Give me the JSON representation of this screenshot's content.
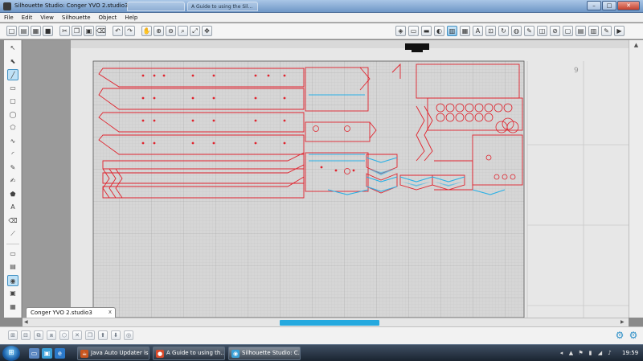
{
  "window": {
    "title": "Silhouette Studio: Conger YVO 2.studio3",
    "ghost_tabs": [
      "",
      "A Guide to using the Sil..."
    ],
    "controls": {
      "minimize": "–",
      "maximize": "□",
      "close": "✕"
    }
  },
  "menu": {
    "items": [
      "File",
      "Edit",
      "View",
      "Silhouette",
      "Object",
      "Help"
    ]
  },
  "toolbar": {
    "left_icons": [
      {
        "name": "new-document-icon",
        "glyph": "□"
      },
      {
        "name": "open-folder-icon",
        "glyph": "▤"
      },
      {
        "name": "open-file-icon",
        "glyph": "▦"
      },
      {
        "name": "save-icon",
        "glyph": "■"
      },
      {
        "name": "cut-icon",
        "glyph": "✂"
      },
      {
        "name": "copy-icon",
        "glyph": "❐"
      },
      {
        "name": "paste-icon",
        "glyph": "▣"
      },
      {
        "name": "clear-icon",
        "glyph": "⌫"
      },
      {
        "name": "undo-icon",
        "glyph": "↶"
      },
      {
        "name": "redo-icon",
        "glyph": "↷"
      },
      {
        "name": "pan-hand-icon",
        "glyph": "✋"
      },
      {
        "name": "zoom-in-icon",
        "glyph": "⊕"
      },
      {
        "name": "zoom-out-icon",
        "glyph": "⊖"
      },
      {
        "name": "zoom-drag-icon",
        "glyph": "⌕"
      },
      {
        "name": "zoom-fit-icon",
        "glyph": "⤢"
      },
      {
        "name": "fit-page-icon",
        "glyph": "✥"
      }
    ],
    "right_icons": [
      {
        "name": "fill-color-icon",
        "glyph": "◈"
      },
      {
        "name": "line-color-icon",
        "glyph": "▭"
      },
      {
        "name": "line-style-icon",
        "glyph": "▬"
      },
      {
        "name": "fill-pattern-icon",
        "glyph": "◐"
      },
      {
        "name": "page-setup-icon",
        "glyph": "▥"
      },
      {
        "name": "grid-settings-icon",
        "glyph": "▦"
      },
      {
        "name": "text-style-icon",
        "glyph": "A"
      },
      {
        "name": "replicate-icon",
        "glyph": "⊡"
      },
      {
        "name": "transform-icon",
        "glyph": "↻"
      },
      {
        "name": "offset-icon",
        "glyph": "◍"
      },
      {
        "name": "trace-icon",
        "glyph": "✎"
      },
      {
        "name": "modify-icon",
        "glyph": "◫"
      },
      {
        "name": "knife-icon",
        "glyph": "⊘"
      },
      {
        "name": "registration-marks-icon",
        "glyph": "▢"
      },
      {
        "name": "store-icon",
        "glyph": "▤"
      },
      {
        "name": "library-icon",
        "glyph": "▥"
      },
      {
        "name": "cut-settings-icon",
        "glyph": "✎"
      },
      {
        "name": "send-to-silhouette-icon",
        "glyph": "▶"
      }
    ]
  },
  "left_tools": [
    {
      "name": "select-tool-icon",
      "glyph": "↖"
    },
    {
      "name": "point-edit-tool-icon",
      "glyph": "⬉"
    },
    {
      "name": "line-tool-icon",
      "glyph": "╱",
      "selected": true
    },
    {
      "name": "rectangle-tool-icon",
      "glyph": "▭"
    },
    {
      "name": "rounded-rectangle-tool-icon",
      "glyph": "▢"
    },
    {
      "name": "ellipse-tool-icon",
      "glyph": "◯"
    },
    {
      "name": "polygon-tool-icon",
      "glyph": "⬠"
    },
    {
      "name": "curve-tool-icon",
      "glyph": "∿"
    },
    {
      "name": "arc-tool-icon",
      "glyph": "◜"
    },
    {
      "name": "freehand-tool-icon",
      "glyph": "✎"
    },
    {
      "name": "smooth-freehand-tool-icon",
      "glyph": "✍"
    },
    {
      "name": "regular-polygon-tool-icon",
      "glyph": "⬟"
    },
    {
      "name": "text-tool-icon",
      "glyph": "A"
    },
    {
      "name": "eraser-tool-icon",
      "glyph": "⌫"
    },
    {
      "name": "knife-tool-icon",
      "glyph": "⟋"
    },
    {
      "name": "page-view-icon",
      "glyph": "▭"
    },
    {
      "name": "library-view-icon",
      "glyph": "▤"
    },
    {
      "name": "store-view-icon",
      "glyph": "◉",
      "selected": true
    },
    {
      "name": "design-view-icon",
      "glyph": "▣"
    },
    {
      "name": "cut-view-icon",
      "glyph": "▦"
    }
  ],
  "document": {
    "tab_label": "Conger YVO 2.studio3",
    "tab_close": "x",
    "ruler_numbers": [
      "9"
    ]
  },
  "bottom_bar": {
    "icons": [
      {
        "name": "group-icon",
        "glyph": "⊞"
      },
      {
        "name": "ungroup-icon",
        "glyph": "⊟"
      },
      {
        "name": "compound-path-icon",
        "glyph": "⧉"
      },
      {
        "name": "release-compound-icon",
        "glyph": "⧈"
      },
      {
        "name": "weld-icon",
        "glyph": "⬡"
      },
      {
        "name": "delete-icon",
        "glyph": "✕"
      },
      {
        "name": "duplicate-icon",
        "glyph": "❐"
      },
      {
        "name": "bring-forward-icon",
        "glyph": "⬆"
      },
      {
        "name": "send-backward-icon",
        "glyph": "⬇"
      },
      {
        "name": "lock-icon",
        "glyph": "◎"
      }
    ],
    "settings_glyph": "⚙"
  },
  "taskbar": {
    "start_glyph": "⊞",
    "quick_launch": [
      {
        "name": "show-desktop-icon",
        "glyph": "▭",
        "color": "#5a86c0"
      },
      {
        "name": "explorer-icon",
        "glyph": "▣",
        "color": "#3aa0d8"
      },
      {
        "name": "ie-icon",
        "glyph": "e",
        "color": "#2b79c9"
      }
    ],
    "tasks": [
      {
        "label": "Java Auto Updater is...",
        "icon": "☕",
        "color": "#c8551e"
      },
      {
        "label": "A Guide to using th...",
        "icon": "●",
        "color": "#d84a2b"
      },
      {
        "label": "Silhouette Studio: C...",
        "icon": "◉",
        "color": "#3aa0d8",
        "active": true
      }
    ],
    "tray_icons": [
      "◂",
      "▲",
      "⚑",
      "▮",
      "◢",
      "♪"
    ],
    "clock": "19:59"
  },
  "colors": {
    "accent": "#25a9df",
    "cut_line": "#e0232d",
    "highlight_line": "#2ab0e5",
    "mat_grid": "#c7c7c7"
  }
}
